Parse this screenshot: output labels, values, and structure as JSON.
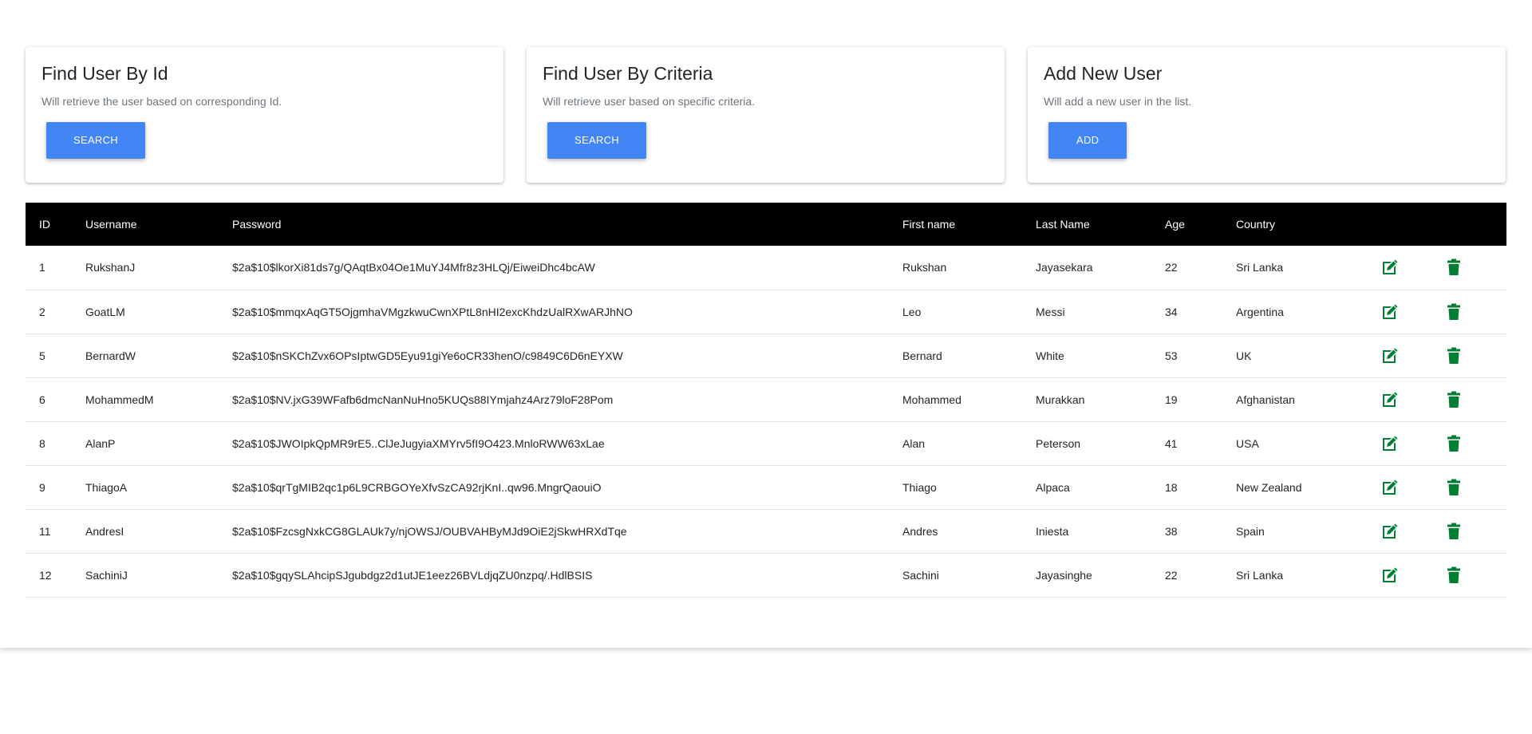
{
  "cards": [
    {
      "title": "Find User By Id",
      "text": "Will retrieve the user based on corresponding Id.",
      "button": "SEARCH"
    },
    {
      "title": "Find User By Criteria",
      "text": "Will retrieve user based on specific criteria.",
      "button": "SEARCH"
    },
    {
      "title": "Add New User",
      "text": "Will add a new user in the list.",
      "button": "ADD"
    }
  ],
  "table": {
    "headers": {
      "id": "ID",
      "username": "Username",
      "password": "Password",
      "first_name": "First name",
      "last_name": "Last Name",
      "age": "Age",
      "country": "Country"
    },
    "rows": [
      {
        "id": "1",
        "username": "RukshanJ",
        "password": "$2a$10$lkorXi81ds7g/QAqtBx04Oe1MuYJ4Mfr8z3HLQj/EiweiDhc4bcAW",
        "first_name": "Rukshan",
        "last_name": "Jayasekara",
        "age": "22",
        "country": "Sri Lanka"
      },
      {
        "id": "2",
        "username": "GoatLM",
        "password": "$2a$10$mmqxAqGT5OjgmhaVMgzkwuCwnXPtL8nHI2excKhdzUalRXwARJhNO",
        "first_name": "Leo",
        "last_name": "Messi",
        "age": "34",
        "country": "Argentina"
      },
      {
        "id": "5",
        "username": "BernardW",
        "password": "$2a$10$nSKChZvx6OPsIptwGD5Eyu91giYe6oCR33henO/c9849C6D6nEYXW",
        "first_name": "Bernard",
        "last_name": "White",
        "age": "53",
        "country": "UK"
      },
      {
        "id": "6",
        "username": "MohammedM",
        "password": "$2a$10$NV.jxG39WFafb6dmcNanNuHno5KUQs88IYmjahz4Arz79loF28Pom",
        "first_name": "Mohammed",
        "last_name": "Murakkan",
        "age": "19",
        "country": "Afghanistan"
      },
      {
        "id": "8",
        "username": "AlanP",
        "password": "$2a$10$JWOIpkQpMR9rE5..ClJeJugyiaXMYrv5fI9O423.MnloRWW63xLae",
        "first_name": "Alan",
        "last_name": "Peterson",
        "age": "41",
        "country": "USA"
      },
      {
        "id": "9",
        "username": "ThiagoA",
        "password": "$2a$10$qrTgMIB2qc1p6L9CRBGOYeXfvSzCA92rjKnI..qw96.MngrQaouiO",
        "first_name": "Thiago",
        "last_name": "Alpaca",
        "age": "18",
        "country": "New Zealand"
      },
      {
        "id": "11",
        "username": "AndresI",
        "password": "$2a$10$FzcsgNxkCG8GLAUk7y/njOWSJ/OUBVAHByMJd9OiE2jSkwHRXdTqe",
        "first_name": "Andres",
        "last_name": "Iniesta",
        "age": "38",
        "country": "Spain"
      },
      {
        "id": "12",
        "username": "SachiniJ",
        "password": "$2a$10$gqySLAhcipSJgubdgz2d1utJE1eez26BVLdjqZU0nzpq/.HdlBSIS",
        "first_name": "Sachini",
        "last_name": "Jayasinghe",
        "age": "22",
        "country": "Sri Lanka"
      }
    ]
  },
  "icons": {
    "edit": "edit-icon",
    "delete": "trash-icon"
  },
  "colors": {
    "button": "#4285f4",
    "header_bg": "#000000",
    "action_icon": "#007e33"
  }
}
